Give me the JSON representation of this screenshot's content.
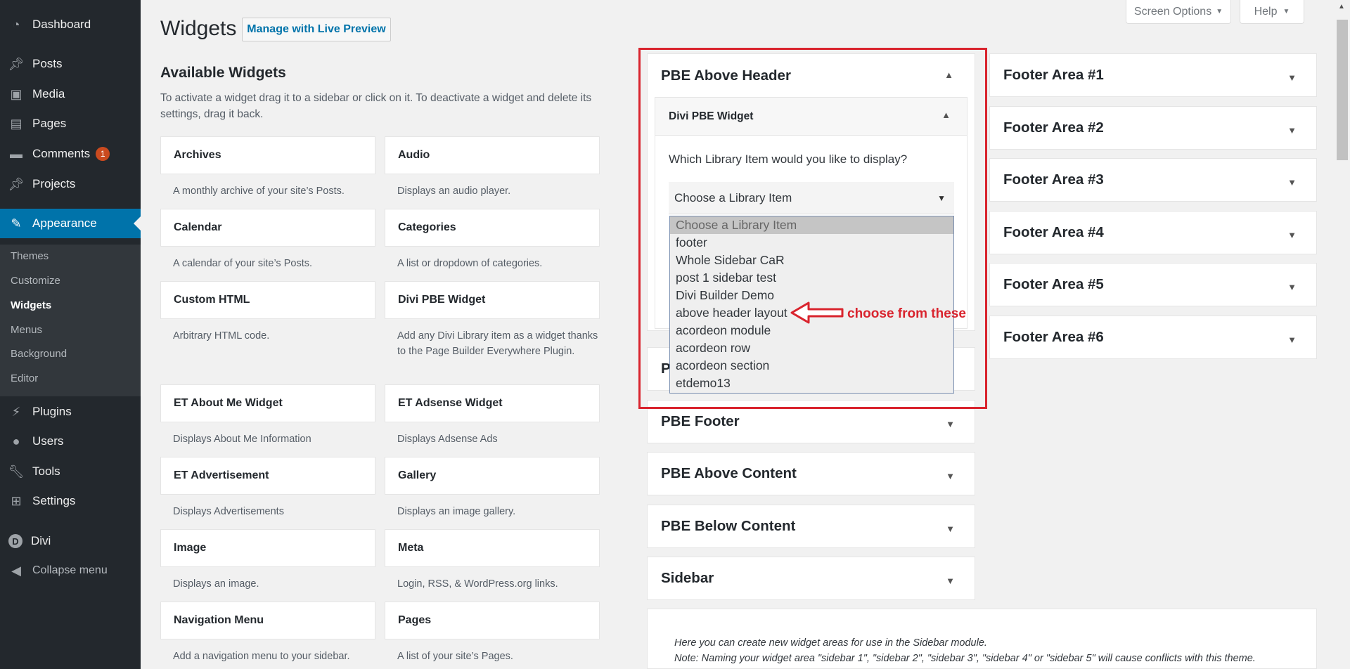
{
  "admin_menu": {
    "items": [
      {
        "label": "Dashboard",
        "icon": "dashboard-icon"
      },
      {
        "label": "Posts",
        "icon": "pin-icon"
      },
      {
        "label": "Media",
        "icon": "media-icon"
      },
      {
        "label": "Pages",
        "icon": "page-icon"
      },
      {
        "label": "Comments",
        "icon": "comment-icon",
        "badge": "1"
      },
      {
        "label": "Projects",
        "icon": "pin-icon"
      },
      {
        "label": "Appearance",
        "icon": "brush-icon"
      },
      {
        "label": "Plugins",
        "icon": "plug-icon"
      },
      {
        "label": "Users",
        "icon": "user-icon"
      },
      {
        "label": "Tools",
        "icon": "wrench-icon"
      },
      {
        "label": "Settings",
        "icon": "settings-icon"
      },
      {
        "label": "Divi",
        "icon": "divi-logo-icon"
      },
      {
        "label": "Collapse menu",
        "icon": "collapse-icon"
      }
    ],
    "submenu": [
      "Themes",
      "Customize",
      "Widgets",
      "Menus",
      "Background",
      "Editor"
    ],
    "accent": "#0073aa",
    "badge_color": "#ca4a1f"
  },
  "top_tabs": {
    "screen_options": "Screen Options",
    "help": "Help"
  },
  "header": {
    "title": "Widgets",
    "live_preview": "Manage with Live Preview"
  },
  "available": {
    "title": "Available Widgets",
    "description": "To activate a widget drag it to a sidebar or click on it. To deactivate a widget and delete its settings, drag it back.",
    "widgets": [
      {
        "name": "Archives",
        "desc": "A monthly archive of your site’s Posts."
      },
      {
        "name": "Audio",
        "desc": "Displays an audio player."
      },
      {
        "name": "Calendar",
        "desc": "A calendar of your site’s Posts."
      },
      {
        "name": "Categories",
        "desc": "A list or dropdown of categories."
      },
      {
        "name": "Custom HTML",
        "desc": "Arbitrary HTML code."
      },
      {
        "name": "Divi PBE Widget",
        "desc": "Add any Divi Library item as a widget thanks to the Page Builder Everywhere Plugin."
      },
      {
        "name": "ET About Me Widget",
        "desc": "Displays About Me Information"
      },
      {
        "name": "ET Adsense Widget",
        "desc": "Displays Adsense Ads"
      },
      {
        "name": "ET Advertisement",
        "desc": "Displays Advertisements"
      },
      {
        "name": "Gallery",
        "desc": "Displays an image gallery."
      },
      {
        "name": "Image",
        "desc": "Displays an image."
      },
      {
        "name": "Meta",
        "desc": "Login, RSS, & WordPress.org links."
      },
      {
        "name": "Navigation Menu",
        "desc": "Add a navigation menu to your sidebar."
      },
      {
        "name": "Pages",
        "desc": "A list of your site’s Pages."
      }
    ]
  },
  "sidebars_left": {
    "open": {
      "title": "PBE Above Header",
      "widget_title": "Divi PBE Widget",
      "question": "Which Library Item would you like to display?",
      "select_value": "Choose a Library Item"
    },
    "hidden_partial": "P",
    "collapsed": [
      "PBE Footer",
      "PBE Above Content",
      "PBE Below Content",
      "Sidebar"
    ]
  },
  "sidebars_right": [
    "Footer Area #1",
    "Footer Area #2",
    "Footer Area #3",
    "Footer Area #4",
    "Footer Area #5",
    "Footer Area #6"
  ],
  "dropdown": {
    "options": [
      "Choose a Library Item",
      "footer",
      "Whole Sidebar CaR",
      "post 1 sidebar test",
      "Divi Builder Demo",
      "above header layout",
      "acordeon module",
      "acordeon row",
      "acordeon section",
      "etdemo13"
    ],
    "highlighted": "Choose a Library Item"
  },
  "annotation": {
    "text": "choose from these",
    "color": "#d9242e"
  },
  "footer_note": {
    "line1": "Here you can create new widget areas for use in the Sidebar module.",
    "line2": "Note: Naming your widget area \"sidebar 1\", \"sidebar 2\", \"sidebar 3\", \"sidebar 4\" or \"sidebar 5\" will cause conflicts with this theme."
  }
}
